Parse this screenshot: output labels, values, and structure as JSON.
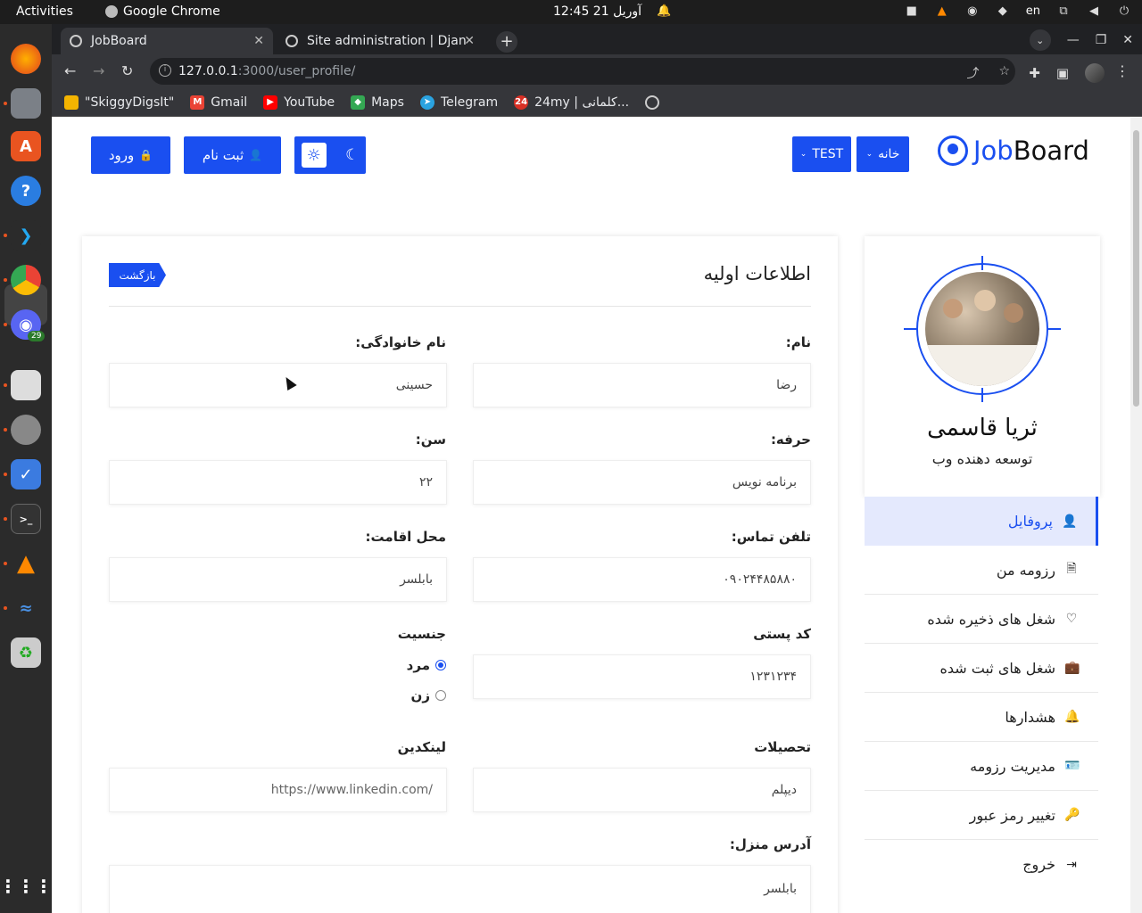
{
  "os": {
    "activities": "Activities",
    "app_name": "Google Chrome",
    "clock": "12:45  آوریل 21",
    "lang": "en"
  },
  "browser": {
    "tabs": [
      {
        "label": "JobBoard",
        "active": true
      },
      {
        "label": "Site administration | Djan",
        "active": false
      }
    ],
    "url_host": "127.0.0.1",
    "url_path": ":3000/user_profile/",
    "bookmarks": [
      {
        "label": "\"SkiggyDigsIt\"",
        "color": "#f4b400"
      },
      {
        "label": "Gmail",
        "color": "#ea4335"
      },
      {
        "label": "YouTube",
        "color": "#ff0000"
      },
      {
        "label": "Maps",
        "color": "#34a853"
      },
      {
        "label": "Telegram",
        "color": "#2aa3e0"
      },
      {
        "label": "24my | کلمانی...",
        "color": "#d93025"
      }
    ]
  },
  "dock": {
    "discord_badge": "29"
  },
  "header": {
    "login": "ورود",
    "register": "ثبت نام",
    "test_menu": "TEST",
    "home_menu": "خانه",
    "logo_part1": "Job",
    "logo_part2": "Board"
  },
  "form": {
    "heading": "اطلاعات اولیه",
    "back": "بازگشت",
    "first_name_label": "نام:",
    "first_name": "رضا",
    "last_name_label": "نام خانوادگی:",
    "last_name": "حسینی",
    "job_label": "حرفه:",
    "job": "برنامه نویس",
    "age_label": "سن:",
    "age": "۲۲",
    "phone_label": "تلفن تماس:",
    "phone": "۰۹۰۲۴۴۸۵۸۸۰",
    "city_label": "محل اقامت:",
    "city": "بابلسر",
    "postal_label": "کد پستی",
    "postal": "۱۲۳۱۲۳۴",
    "gender_label": "جنسیت",
    "gender_male": "مرد",
    "gender_female": "زن",
    "education_label": "تحصیلات",
    "education": "دیپلم",
    "linkedin_label": "لینکدین",
    "linkedin": "https://www.linkedin.com/",
    "address_label": "آدرس منزل:",
    "address": "بابلسر"
  },
  "profile": {
    "name": "ثریا قاسمی",
    "title": "توسعه دهنده وب"
  },
  "menu": [
    {
      "label": "پروفایل",
      "icon": "user-icon",
      "glyph": "👤"
    },
    {
      "label": "رزومه من",
      "icon": "document-icon",
      "glyph": "🗎"
    },
    {
      "label": "شغل های ذخیره شده",
      "icon": "heart-icon",
      "glyph": "♡"
    },
    {
      "label": "شغل های ثبت شده",
      "icon": "briefcase-icon",
      "glyph": "💼"
    },
    {
      "label": "هشدارها",
      "icon": "bell-icon",
      "glyph": "🔔"
    },
    {
      "label": "مدیریت رزومه",
      "icon": "id-card-icon",
      "glyph": "🪪"
    },
    {
      "label": "تغییر رمز عبور",
      "icon": "key-icon",
      "glyph": "🔑"
    },
    {
      "label": "خروج",
      "icon": "logout-icon",
      "glyph": "⇥"
    }
  ]
}
